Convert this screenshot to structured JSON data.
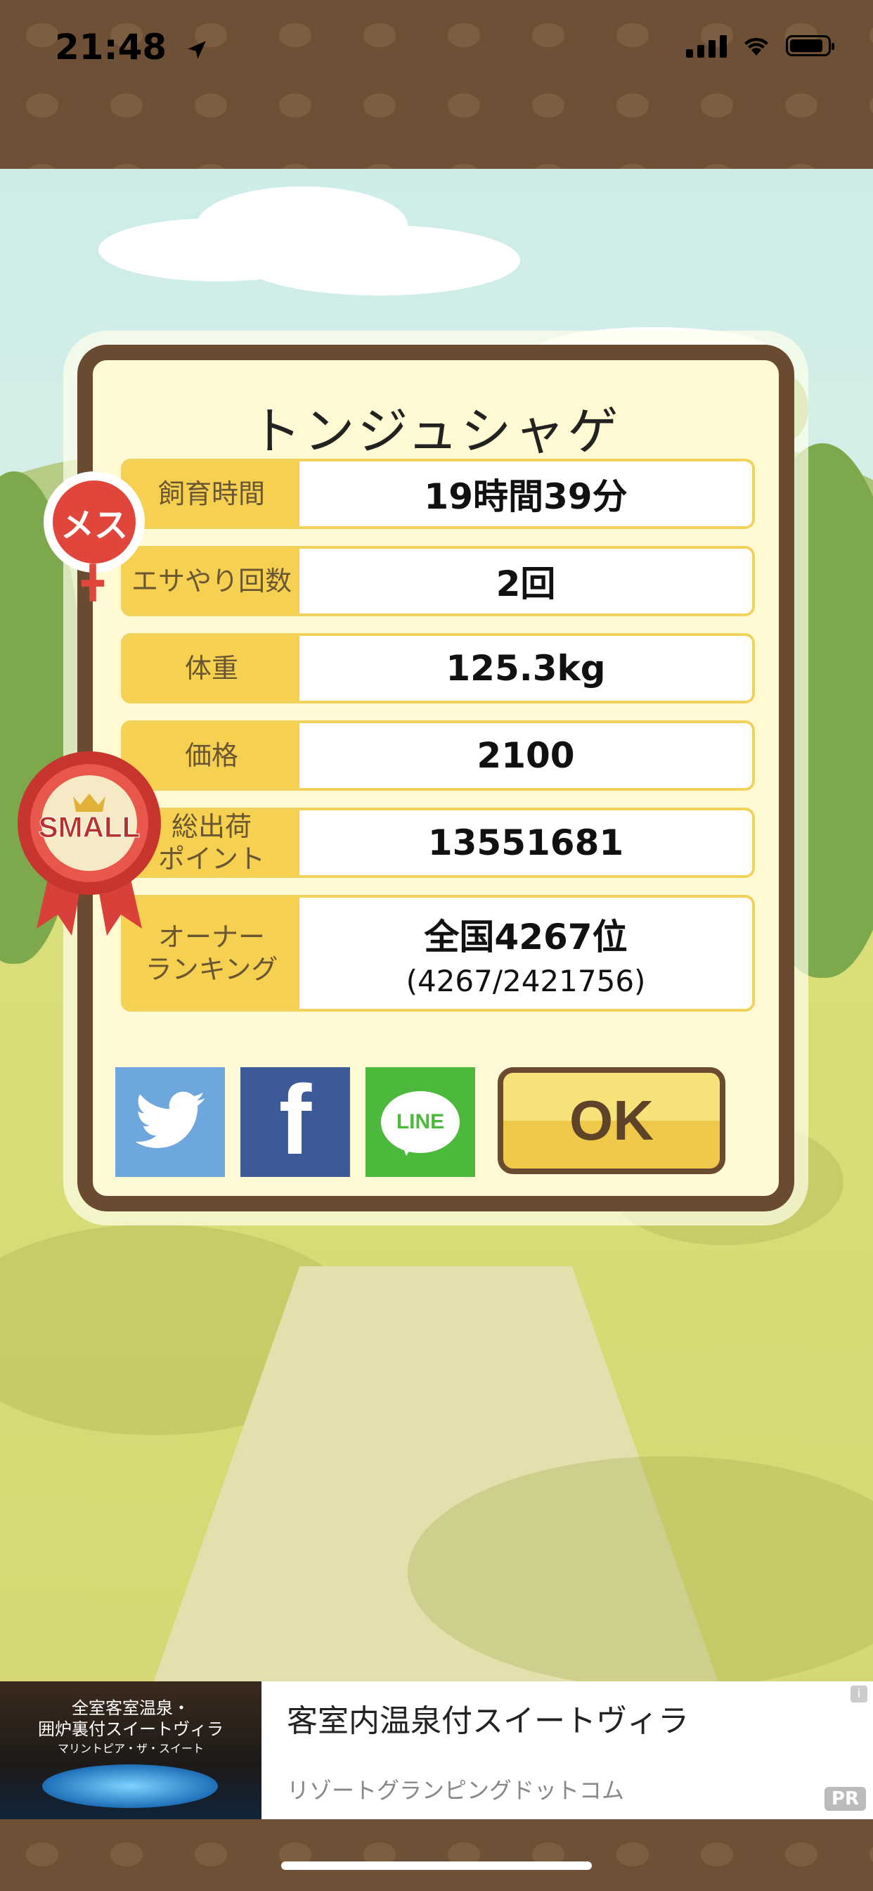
{
  "status_bar": {
    "time": "21:48"
  },
  "game": {
    "creature_name": "トンジュシャゲ",
    "gender_label": "メス",
    "size_badge": "SMALL",
    "stats": [
      {
        "label": "飼育時間",
        "value": "19時間39分",
        "sub": ""
      },
      {
        "label": "エサやり回数",
        "value": "2回",
        "sub": ""
      },
      {
        "label": "体重",
        "value": "125.3kg",
        "sub": ""
      },
      {
        "label": "価格",
        "value": "2100",
        "sub": ""
      },
      {
        "label": "総出荷\nポイント",
        "value": "13551681",
        "sub": ""
      },
      {
        "label": "オーナー\nランキング",
        "value": "全国4267位",
        "sub": "(4267/2421756)"
      }
    ],
    "ok_label": "OK",
    "line_label": "LINE"
  },
  "ad": {
    "headline": "客室内温泉付スイートヴィラ",
    "advertiser": "リゾートグランピングドットコム",
    "image_text_1": "全室客室温泉・",
    "image_text_2": "囲炉裏付スイートヴィラ",
    "image_text_3": "マリントピア・ザ・スイート",
    "pr_label": "PR",
    "info_label": "i"
  },
  "colors": {
    "frame_brown": "#6a4a30",
    "label_yellow": "#f6d151",
    "twitter_blue": "#6ea6de",
    "facebook_blue": "#3d5a98",
    "line_green": "#4cb83c",
    "female_red": "#e0463c"
  }
}
